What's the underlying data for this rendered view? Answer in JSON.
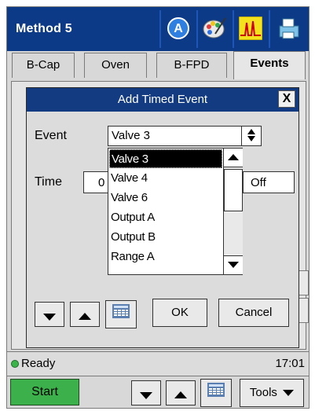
{
  "header": {
    "title": "Method 5",
    "icons": [
      "at-sign-icon",
      "palette-icon",
      "chromatogram-icon",
      "printer-icon"
    ]
  },
  "tabs": [
    {
      "label": "B-Cap",
      "active": false
    },
    {
      "label": "Oven",
      "active": false
    },
    {
      "label": "B-FPD",
      "active": false
    },
    {
      "label": "Events",
      "active": true
    }
  ],
  "dialog": {
    "title": "Add Timed Event",
    "close_label": "X",
    "event_label": "Event",
    "event_value": "Valve 3",
    "time_label": "Time",
    "time_value": "0",
    "state_value": "Off",
    "event_options": [
      "Valve 3",
      "Valve 4",
      "Valve 6",
      "Output A",
      "Output B",
      "Range A"
    ],
    "ok_label": "OK",
    "cancel_label": "Cancel"
  },
  "status": {
    "text": "Ready",
    "time": "17:01",
    "led_color": "#3bb54a"
  },
  "toolbar": {
    "start_label": "Start",
    "tools_label": "Tools"
  },
  "colors": {
    "titlebar": "#0c3a86",
    "dialog_title": "#123b82",
    "start": "#3cb04a"
  }
}
